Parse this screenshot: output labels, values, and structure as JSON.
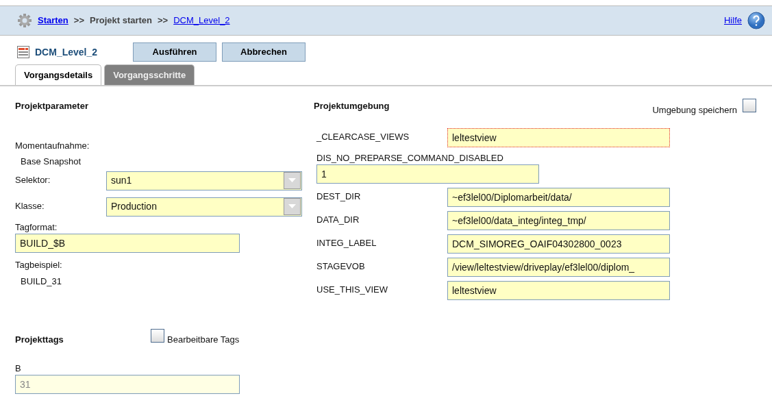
{
  "breadcrumb": {
    "items": [
      {
        "text": "Starten",
        "kind": "link"
      },
      {
        "text": ">>",
        "kind": "separator"
      },
      {
        "text": "Projekt starten",
        "kind": "current"
      },
      {
        "text": ">>",
        "kind": "separator"
      },
      {
        "text": "DCM_Level_2",
        "kind": "link"
      }
    ],
    "help": "Hilfe"
  },
  "title": "DCM_Level_2",
  "buttons": [
    "Ausführen",
    "Abbrechen"
  ],
  "tabs": [
    {
      "label": "Vorgangsdetails",
      "selected": true
    },
    {
      "label": "Vorgangsschritte",
      "selected": false
    }
  ],
  "parameters": {
    "heading": "Projektparameter",
    "snapshot_label": "Momentaufnahme:",
    "snapshot_value": "Base Snapshot",
    "selector": {
      "label": "Selektor:",
      "value": "sun1"
    },
    "class": {
      "label": "Klasse:",
      "value": "Production"
    },
    "tagformat": {
      "label": "Tagformat:",
      "value": "BUILD_$B"
    },
    "tagexample_label": "Tagbeispiel:",
    "tagexample_value": "BUILD_31"
  },
  "environment": {
    "heading": "Projektumgebung",
    "save_label": "Umgebung speichern",
    "save_checked": false,
    "variables": [
      {
        "name": "_CLEARCASE_VIEWS",
        "value": "leltestview",
        "kind": "inline",
        "error": true
      },
      {
        "name": "DIS_NO_PREPARSE_COMMAND_DISABLED",
        "value": "1",
        "kind": "stacked",
        "error": false
      },
      {
        "name": "DEST_DIR",
        "value": "~ef3lel00/Diplomarbeit/data/",
        "kind": "inline",
        "error": false
      },
      {
        "name": "DATA_DIR",
        "value": "~ef3lel00/data_integ/integ_tmp/",
        "kind": "inline",
        "error": false
      },
      {
        "name": "INTEG_LABEL",
        "value": "DCM_SIMOREG_OAIF04302800_0023",
        "kind": "inline",
        "error": false
      },
      {
        "name": "STAGEVOB",
        "value": "/view/leltestview/driveplay/ef3lel00/diplom_",
        "kind": "inline",
        "error": false
      },
      {
        "name": "USE_THIS_VIEW",
        "value": "leltestview",
        "kind": "inline",
        "error": false
      }
    ]
  },
  "tags": {
    "heading": "Projekttags",
    "editable_label": "Bearbeitbare Tags",
    "editable_checked": false,
    "items": [
      {
        "name": "B",
        "value": "31",
        "disabled": true
      }
    ]
  }
}
